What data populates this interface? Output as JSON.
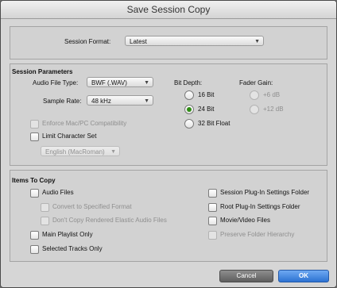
{
  "window": {
    "title": "Save Session Copy"
  },
  "session_format": {
    "label": "Session Format:",
    "value": "Latest"
  },
  "session_parameters": {
    "heading": "Session Parameters",
    "audio_file_type": {
      "label": "Audio File Type:",
      "value": "BWF (.WAV)"
    },
    "sample_rate": {
      "label": "Sample Rate:",
      "value": "48 kHz"
    },
    "enforce_compat": {
      "label": "Enforce Mac/PC Compatibility",
      "checked": false,
      "disabled": true
    },
    "limit_charset": {
      "label": "Limit Character Set",
      "checked": false
    },
    "charset_select": {
      "value": "English (MacRoman)",
      "disabled": true
    },
    "bit_depth": {
      "label": "Bit Depth:",
      "options": [
        "16 Bit",
        "24 Bit",
        "32 Bit Float"
      ],
      "selected": "24 Bit"
    },
    "fader_gain": {
      "label": "Fader Gain:",
      "options": [
        "+6 dB",
        "+12 dB"
      ],
      "disabled": true
    }
  },
  "items_to_copy": {
    "heading": "Items To Copy",
    "left": [
      {
        "label": "Audio Files",
        "disabled": false
      },
      {
        "label": "Convert to Specified Format",
        "disabled": true
      },
      {
        "label": "Don't Copy Rendered Elastic Audio Files",
        "disabled": true
      },
      {
        "label": "Main Playlist Only",
        "disabled": false
      },
      {
        "label": "Selected Tracks Only",
        "disabled": false
      }
    ],
    "right": [
      {
        "label": "Session Plug-In Settings Folder",
        "disabled": false
      },
      {
        "label": "Root Plug-In Settings Folder",
        "disabled": false
      },
      {
        "label": "Movie/Video Files",
        "disabled": false
      },
      {
        "label": "Preserve Folder Hierarchy",
        "disabled": true
      }
    ]
  },
  "buttons": {
    "cancel": "Cancel",
    "ok": "OK"
  }
}
